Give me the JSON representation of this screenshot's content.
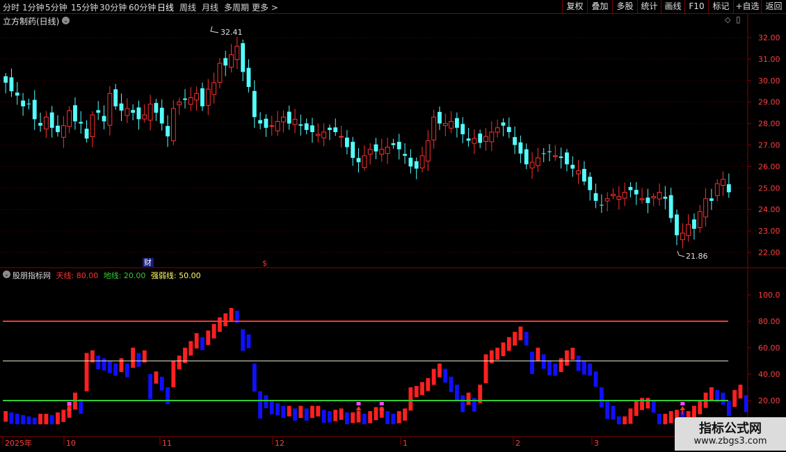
{
  "toolbar": {
    "periods": [
      "分时",
      "1分钟",
      "5分钟",
      "15分钟",
      "30分钟",
      "60分钟",
      "日线",
      "周线",
      "月线",
      "多周期",
      "更多"
    ],
    "more_arrow": ">",
    "buttons": [
      "复权",
      "叠加",
      "多股",
      "统计",
      "画线",
      "F10",
      "标记",
      "+自选",
      "返回"
    ]
  },
  "main_panel": {
    "title": "立方制药(日线)",
    "high_label": "32.41",
    "low_label": "21.86",
    "event_markers": [
      "财",
      "$"
    ],
    "price_axis": [
      "32.00",
      "31.00",
      "30.00",
      "29.00",
      "28.00",
      "27.00",
      "26.00",
      "25.00",
      "24.00",
      "23.00",
      "22.00"
    ],
    "icons": [
      "dropdown-icon",
      "diamond-icon",
      "menu-icon"
    ]
  },
  "indicator_panel": {
    "name": "股朋指标网",
    "line1_label": "天线: 80.00",
    "line2_label": "地线: 20.00",
    "line3_label": "强弱线: 50.00",
    "value_axis": [
      "100.0",
      "80.00",
      "60.00",
      "40.00",
      "20.00"
    ],
    "colors": {
      "sky": "#ff3333",
      "ground": "#33cc33",
      "mid": "#ffff66",
      "up": "#ff2020",
      "down": "#1010ff",
      "signal": "#ff44ff"
    }
  },
  "date_axis": [
    "2025年",
    "10",
    "11",
    "12",
    "1",
    "2",
    "3"
  ],
  "watermark": {
    "main": "指标公式网",
    "sub": "www.zbgs3.com"
  },
  "chart_data": [
    {
      "type": "candlestick",
      "title": "立方制药(日线)",
      "ylim": [
        21.5,
        32.9
      ],
      "high_marker": 32.41,
      "low_marker": 21.86,
      "x_ticks": [
        "2025年",
        "10",
        "11",
        "12",
        "1",
        "2",
        "3"
      ],
      "close": [
        29.9,
        29.5,
        29.3,
        28.8,
        28.9,
        28.2,
        27.9,
        28.3,
        27.8,
        27.6,
        27.9,
        28.6,
        28.1,
        28.0,
        27.3,
        28.4,
        28.5,
        28.1,
        29.4,
        28.8,
        28.6,
        28.7,
        28.5,
        28.2,
        28.4,
        28.9,
        28.5,
        28.0,
        27.4,
        28.7,
        29.0,
        29.1,
        29.2,
        29.4,
        28.8,
        29.6,
        29.9,
        30.8,
        30.7,
        31.2,
        31.6,
        30.4,
        29.7,
        28.3,
        28.0,
        27.8,
        27.9,
        28.1,
        28.3,
        28.0,
        28.2,
        27.9,
        27.7,
        27.6,
        27.5,
        27.6,
        27.7,
        27.6,
        27.4,
        26.9,
        26.4,
        26.2,
        26.5,
        26.8,
        26.7,
        26.8,
        26.9,
        27.0,
        26.8,
        26.5,
        26.0,
        25.9,
        26.5,
        27.2,
        28.3,
        28.0,
        28.0,
        28.1,
        27.8,
        27.5,
        27.2,
        27.3,
        27.1,
        27.4,
        27.6,
        27.8,
        27.9,
        27.6,
        27.0,
        26.6,
        26.1,
        26.2,
        26.4,
        26.6,
        26.7,
        26.5,
        26.4,
        26.1,
        25.9,
        25.8,
        25.3,
        24.9,
        24.4,
        24.2,
        24.5,
        24.7,
        24.6,
        24.8,
        24.9,
        24.7,
        24.5,
        24.3,
        24.6,
        24.8,
        24.5,
        23.6,
        22.8,
        22.9,
        23.3,
        23.1,
        23.9,
        24.5,
        24.4,
        25.2,
        25.4,
        24.8
      ]
    },
    {
      "type": "bar",
      "title": "股朋指标网",
      "ylim": [
        0,
        115
      ],
      "reference_lines": [
        {
          "name": "天线",
          "value": 80.0
        },
        {
          "name": "地线",
          "value": 20.0
        },
        {
          "name": "强弱线",
          "value": 50.0
        }
      ],
      "values": [
        12,
        11,
        10,
        9,
        8,
        7,
        10,
        10,
        9,
        11,
        13,
        18,
        26,
        21,
        56,
        58,
        54,
        52,
        50,
        48,
        52,
        48,
        60,
        56,
        58,
        40,
        42,
        38,
        30,
        50,
        54,
        60,
        65,
        71,
        68,
        73,
        78,
        83,
        86,
        90,
        88,
        74,
        70,
        48,
        27,
        24,
        20,
        18,
        16,
        16,
        14,
        16,
        14,
        16,
        16,
        13,
        12,
        13,
        14,
        11,
        11,
        12,
        10,
        12,
        15,
        15,
        12,
        10,
        12,
        14,
        30,
        31,
        34,
        37,
        44,
        48,
        44,
        38,
        32,
        24,
        26,
        22,
        32,
        55,
        58,
        60,
        64,
        68,
        72,
        76,
        72,
        57,
        60,
        55,
        50,
        48,
        52,
        58,
        60,
        54,
        50,
        48,
        42,
        30,
        20,
        16,
        8,
        8,
        14,
        20,
        22,
        22,
        20,
        10,
        10,
        12,
        13,
        12,
        12,
        16,
        20,
        26,
        30,
        28,
        26,
        20,
        28,
        32,
        24
      ]
    }
  ]
}
